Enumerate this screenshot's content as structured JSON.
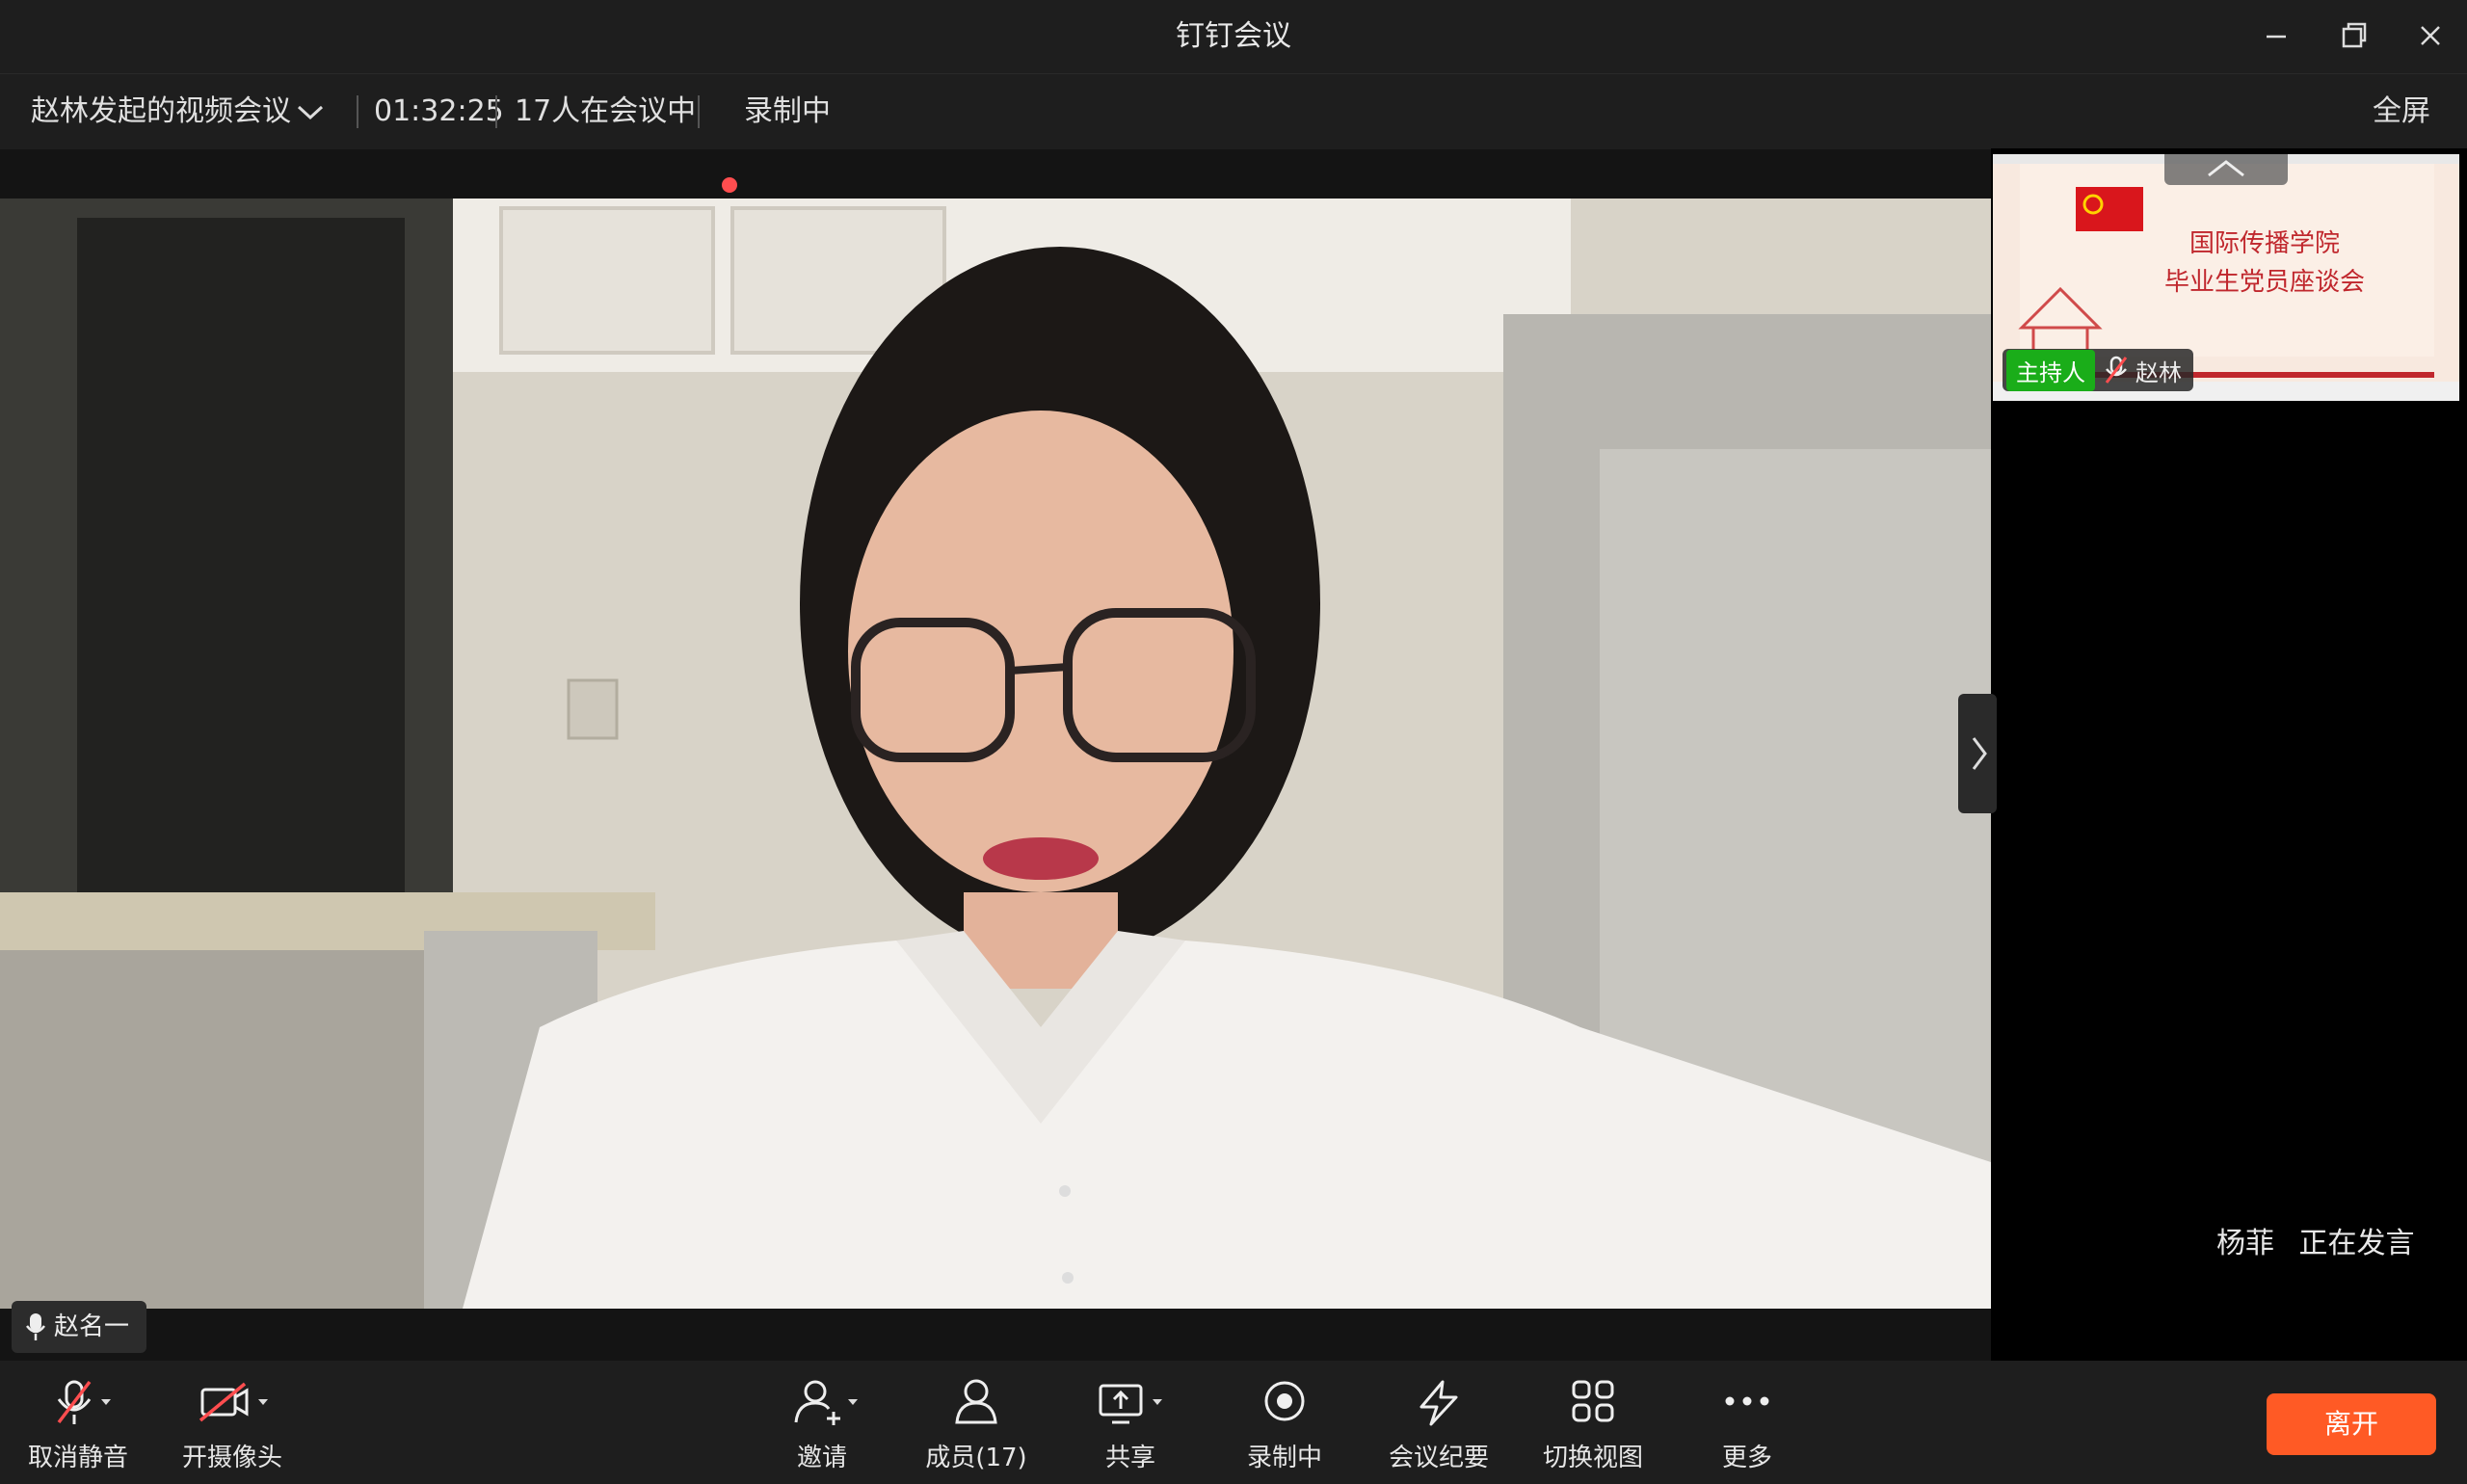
{
  "window": {
    "title": "钉钉会议"
  },
  "info": {
    "meeting_title": "赵林发起的视频会议",
    "duration": "01:32:25",
    "participants": "17人在会议中",
    "recording": "录制中",
    "fullscreen": "全屏"
  },
  "main_video": {
    "speaker_name": "赵名一"
  },
  "side": {
    "slide_line1": "国际传播学院",
    "slide_line2": "毕业生党员座谈会",
    "host_badge": "主持人",
    "host_name": "赵林",
    "speaking_name": "杨菲",
    "speaking_status": "正在发言"
  },
  "toolbar": {
    "unmute": "取消静音",
    "camera": "开摄像头",
    "invite": "邀请",
    "members": "成员(17)",
    "share": "共享",
    "record": "录制中",
    "minutes": "会议纪要",
    "switch_view": "切换视图",
    "more": "更多",
    "leave": "离开"
  },
  "colors": {
    "leave": "#ff5a25",
    "recording_dot": "#ff4d4f",
    "host_badge": "#1aad19"
  }
}
